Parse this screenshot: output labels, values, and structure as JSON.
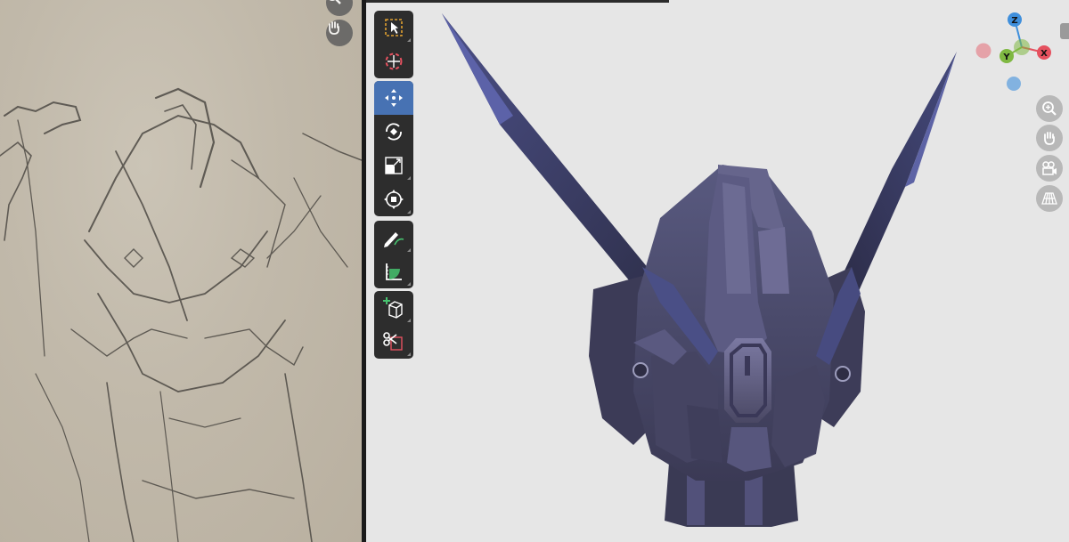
{
  "reference_panel": {
    "zoom_icon": "magnifier-icon",
    "pan_icon": "hand-icon"
  },
  "toolbar": {
    "groups": [
      [
        "select-box-tool",
        "cursor-tool"
      ],
      [
        "move-tool",
        "rotate-tool",
        "scale-tool",
        "transform-tool"
      ],
      [
        "annotate-tool",
        "measure-tool"
      ],
      [
        "add-cube-tool",
        "cut-tool"
      ]
    ],
    "active_tool": "move-tool"
  },
  "gizmo": {
    "axis_z": "Z",
    "axis_y": "Y",
    "axis_x": "X",
    "colors": {
      "x": "#e5515f",
      "y": "#7fb842",
      "z": "#3f8fdc"
    }
  },
  "navigation": [
    "zoom-icon",
    "hand-pan-icon",
    "camera-icon",
    "grid-perspective-icon"
  ],
  "colors": {
    "viewport_bg": "#e6e6e6",
    "toolbar_bg": "#2d2d2d",
    "active_tool": "#4772b3"
  }
}
